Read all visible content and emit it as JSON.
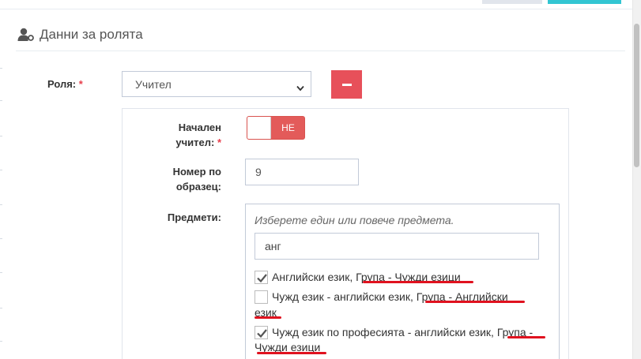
{
  "section": {
    "title": "Данни за ролята",
    "icon": "user-key-icon"
  },
  "form": {
    "role": {
      "label": "Роля:",
      "required": "*",
      "value": "Учител"
    },
    "main_teacher": {
      "label_line1": "Начален",
      "label_line2": "учител:",
      "required": "*",
      "toggle_state": "НЕ"
    },
    "number": {
      "label_line1": "Номер по",
      "label_line2": "образец:",
      "value": "9"
    },
    "subjects": {
      "label": "Предмети:",
      "placeholder": "Изберете един или повече предмета.",
      "search_value": "анг",
      "options": [
        {
          "line1": "Английски език, Група - Чужди езици",
          "line2": "",
          "checked": true
        },
        {
          "line1": "Чужд език - английски език, Група - Английски",
          "line2": "език",
          "checked": false
        },
        {
          "line1": "Чужд език по професията - английски език, Група -",
          "line2": "Чужди езици",
          "checked": true
        }
      ]
    }
  },
  "colors": {
    "remove_button": "#e7505a",
    "toggle_off": "#e35b5a",
    "required": "#e73d4a",
    "underline": "#e0121f"
  }
}
